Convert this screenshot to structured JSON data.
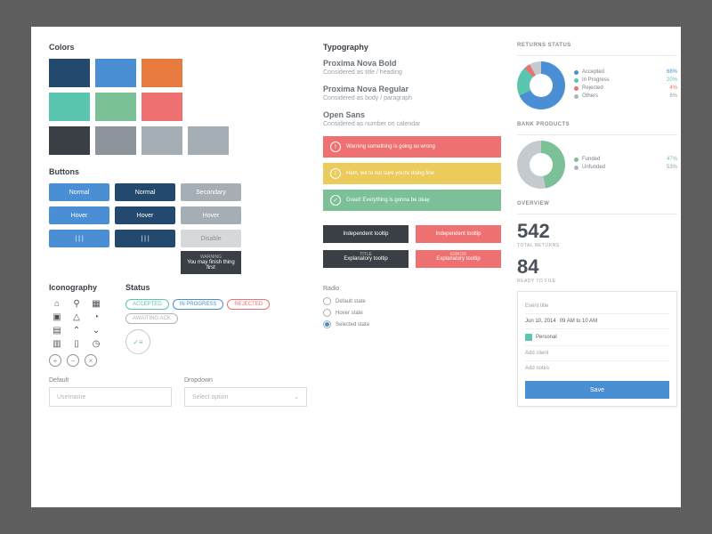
{
  "colors": {
    "title": "Colors",
    "swatches": [
      "#234a6e",
      "#4a8fd3",
      "#e77a3e",
      "#ffffff00",
      "#5bc6b0",
      "#7bc096",
      "#ef7070",
      "#ffffff00",
      "#3a3f46",
      "#8e949b",
      "#a6aeb5",
      "#a6aeb5"
    ]
  },
  "buttons": {
    "title": "Buttons",
    "normal": "Normal",
    "hover": "Hover",
    "secondary": "Secondary",
    "disable": "Disable",
    "loading": "| | |"
  },
  "warning_tooltip": {
    "label": "WARNING",
    "text": "You may finish thing first"
  },
  "iconography": {
    "title": "Iconography"
  },
  "status": {
    "title": "Status",
    "accepted": "ACCEPTED",
    "in_progress": "IN PROGRESS",
    "rejected": "REJECTED",
    "awaiting": "AWAITING ACK"
  },
  "form": {
    "default": "Default",
    "dropdown": "Dropdown",
    "username_ph": "Username",
    "select_ph": "Select option"
  },
  "typography": {
    "title": "Typography",
    "items": [
      {
        "name": "Proxima Nova Bold",
        "desc": "Considered as title / heading"
      },
      {
        "name": "Proxima Nova Regular",
        "desc": "Considered as body / paragraph"
      },
      {
        "name": "Open Sans",
        "desc": "Considered as number on calendar"
      }
    ]
  },
  "alerts": {
    "error": "Warning something is going so wrong",
    "warn": "Hem, we're not sure you're doing fine",
    "ok": "Great! Everything is gonna be okay"
  },
  "tooltips": {
    "independent": "Independent tooltip",
    "title_lbl": "TITLE",
    "error_lbl": "ERROR",
    "explanatory": "Explanatory tooltip"
  },
  "radio": {
    "title": "Radio",
    "default": "Default state",
    "hover": "Hover state",
    "selected": "Selected state"
  },
  "returns": {
    "title": "RETURNS STATUS",
    "legend": [
      {
        "label": "Accepted",
        "val": "68%",
        "color": "#4a8fd3"
      },
      {
        "label": "In Progress",
        "val": "20%",
        "color": "#5bc6b0"
      },
      {
        "label": "Rejected",
        "val": "4%",
        "color": "#ef7070"
      },
      {
        "label": "Others",
        "val": "8%",
        "color": "#b0b5ba"
      }
    ]
  },
  "bank": {
    "title": "BANK PRODUCTS",
    "legend": [
      {
        "label": "Funded",
        "val": "47%",
        "color": "#7bc096"
      },
      {
        "label": "Unfunded",
        "val": "53%",
        "color": "#b0b5ba"
      }
    ]
  },
  "overview": {
    "title": "OVERVIEW",
    "total_num": "542",
    "total_lbl": "TOTAL RETURNS",
    "ready_num": "84",
    "ready_lbl": "READY TO FILE"
  },
  "popup": {
    "event": "Event title",
    "date": "Jun 10, 2014",
    "time": "09 AM to 10 AM",
    "personal": "Personal",
    "add_client": "Add client",
    "add_notes": "Add notes",
    "save": "Save"
  },
  "chart_data": [
    {
      "type": "pie",
      "title": "Returns Status",
      "series": [
        {
          "name": "Accepted",
          "value": 68
        },
        {
          "name": "In Progress",
          "value": 20
        },
        {
          "name": "Rejected",
          "value": 4
        },
        {
          "name": "Others",
          "value": 8
        }
      ]
    },
    {
      "type": "pie",
      "title": "Bank Products",
      "series": [
        {
          "name": "Funded",
          "value": 47
        },
        {
          "name": "Unfunded",
          "value": 53
        }
      ]
    }
  ]
}
